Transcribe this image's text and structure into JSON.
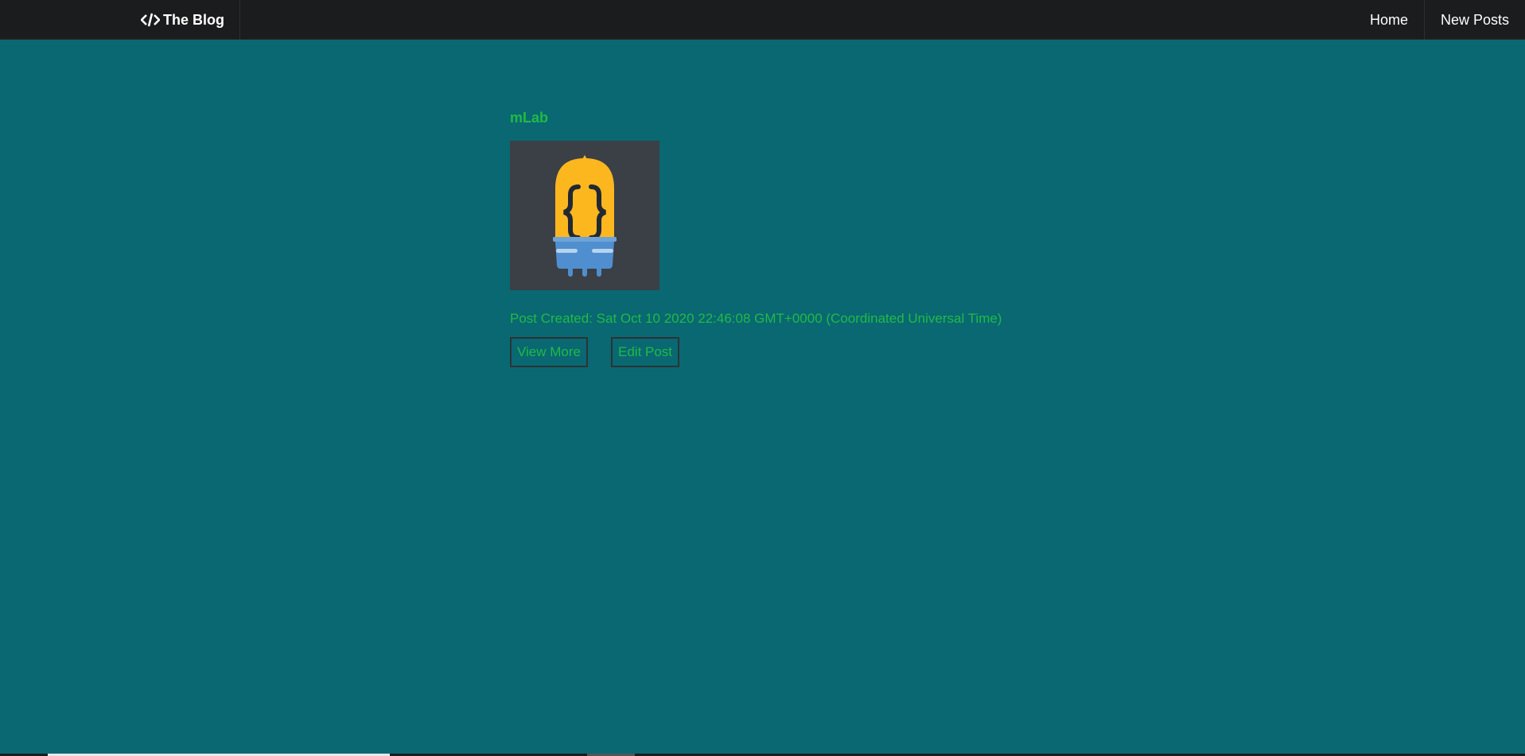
{
  "navbar": {
    "brand_icon": "code-icon",
    "brand_label": "The Blog",
    "items": [
      {
        "label": "Home"
      },
      {
        "label": "New Posts"
      }
    ]
  },
  "post": {
    "title": "mLab",
    "image_icon": "mlab-logo",
    "created": "Post Created: Sat Oct 10 2020 22:46:08 GMT+0000 (Coordinated Universal Time)",
    "view_more_label": "View More",
    "edit_label": "Edit Post"
  },
  "colors": {
    "background": "#096872",
    "navbar": "#1b1c1d",
    "accent_green": "#21ba45",
    "image_bg": "#3b3f46"
  }
}
